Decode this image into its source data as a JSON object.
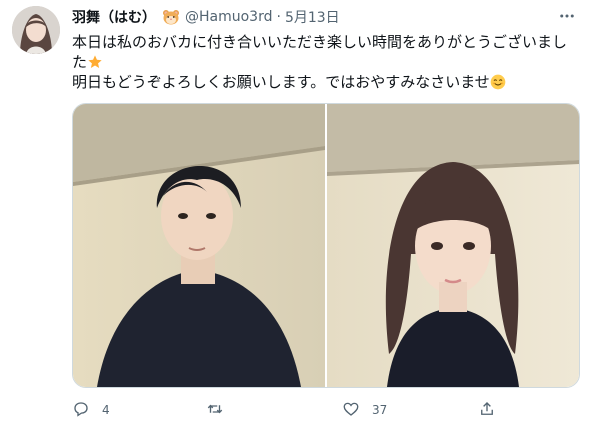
{
  "tweet": {
    "display_name": "羽舞（はむ）",
    "handle": "@Hamuo3rd",
    "separator": "·",
    "date": "5月13日",
    "text_line1": "本日は私のおバカに付き合いいただき楽しい時間をありがとうございまし",
    "text_line2": "た",
    "text_line3": "明日もどうぞよろしくお願いします。ではおやすみなさいませ",
    "icons": {
      "verified_badge": "hamster-face-emoji",
      "star": "star-emoji",
      "smile": "smiling-face-emoji",
      "more": "more-icon",
      "reply": "reply-icon",
      "retweet": "retweet-icon",
      "like": "like-icon",
      "share": "share-icon"
    },
    "reply_count": "4",
    "retweet_count": "",
    "like_count": "37",
    "colors": {
      "text": "#0f1419",
      "secondary": "#536471",
      "border": "#cfd9de"
    }
  }
}
